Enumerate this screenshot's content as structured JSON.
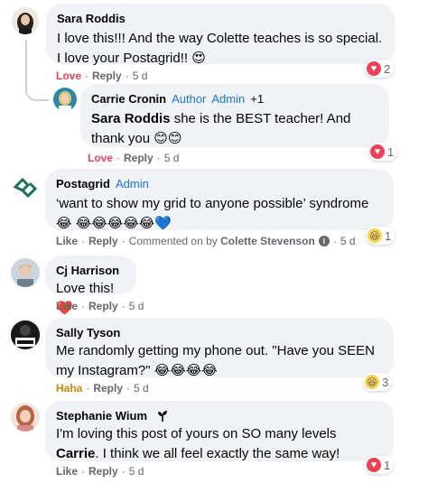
{
  "colors": {
    "bubble": "#f0f2f5",
    "link_blue": "#1b74e4",
    "love_red": "#f33e58",
    "haha_yellow": "#c48b07",
    "meta_gray": "#65676b"
  },
  "comments": [
    {
      "author": "Sara Roddis",
      "text": "I love this!!! And the way Colette teaches is so special. I love your Postagrid!! 😍",
      "actions": {
        "reaction": "Love",
        "reply": "Reply",
        "time": "5 d"
      },
      "reactions": {
        "icon": "heart-icon",
        "count": "2"
      }
    },
    {
      "author": "Carrie Cronin",
      "badges": [
        "Author",
        "Admin"
      ],
      "extra": "+1",
      "mention": "Sara Roddis",
      "text": " she is the BEST teacher! And thank you 😊😊",
      "actions": {
        "reaction": "Love",
        "reply": "Reply",
        "time": "5 d"
      },
      "reactions": {
        "icon": "heart-icon",
        "count": "1"
      }
    },
    {
      "author": "Postagrid",
      "badges": [
        "Admin"
      ],
      "text": "‘want to show my grid to anyone possible’ syndrome 😂 😂😂😂😂😂💙",
      "actions": {
        "reaction": "Like",
        "reply": "Reply",
        "commented_on": "Commented on by",
        "commented_by": "Colette Stevenson",
        "time": "5 d"
      },
      "reactions": {
        "icon": "haha-icon",
        "count": "1"
      }
    },
    {
      "author": "Cj Harrison",
      "text": "Love this!❤️",
      "actions": {
        "reaction": "Like",
        "reply": "Reply",
        "time": "5 d"
      }
    },
    {
      "author": "Sally Tyson",
      "text": "Me randomly getting my phone out. \"Have you SEEN my Instagram?\" 😂😂😂😂",
      "actions": {
        "reaction": "Haha",
        "reply": "Reply",
        "time": "5 d"
      },
      "reactions": {
        "icon": "haha-icon",
        "count": "3"
      }
    },
    {
      "author": "Stephanie Wium",
      "text_before": "I'm loving this post of yours on SO many levels ",
      "mention": "Carrie",
      "text_after": ". I think we all feel exactly the same way!",
      "actions": {
        "reaction": "Like",
        "reply": "Reply",
        "time": "5 d"
      },
      "reactions": {
        "icon": "heart-icon",
        "count": "1"
      }
    }
  ],
  "separator": "·"
}
